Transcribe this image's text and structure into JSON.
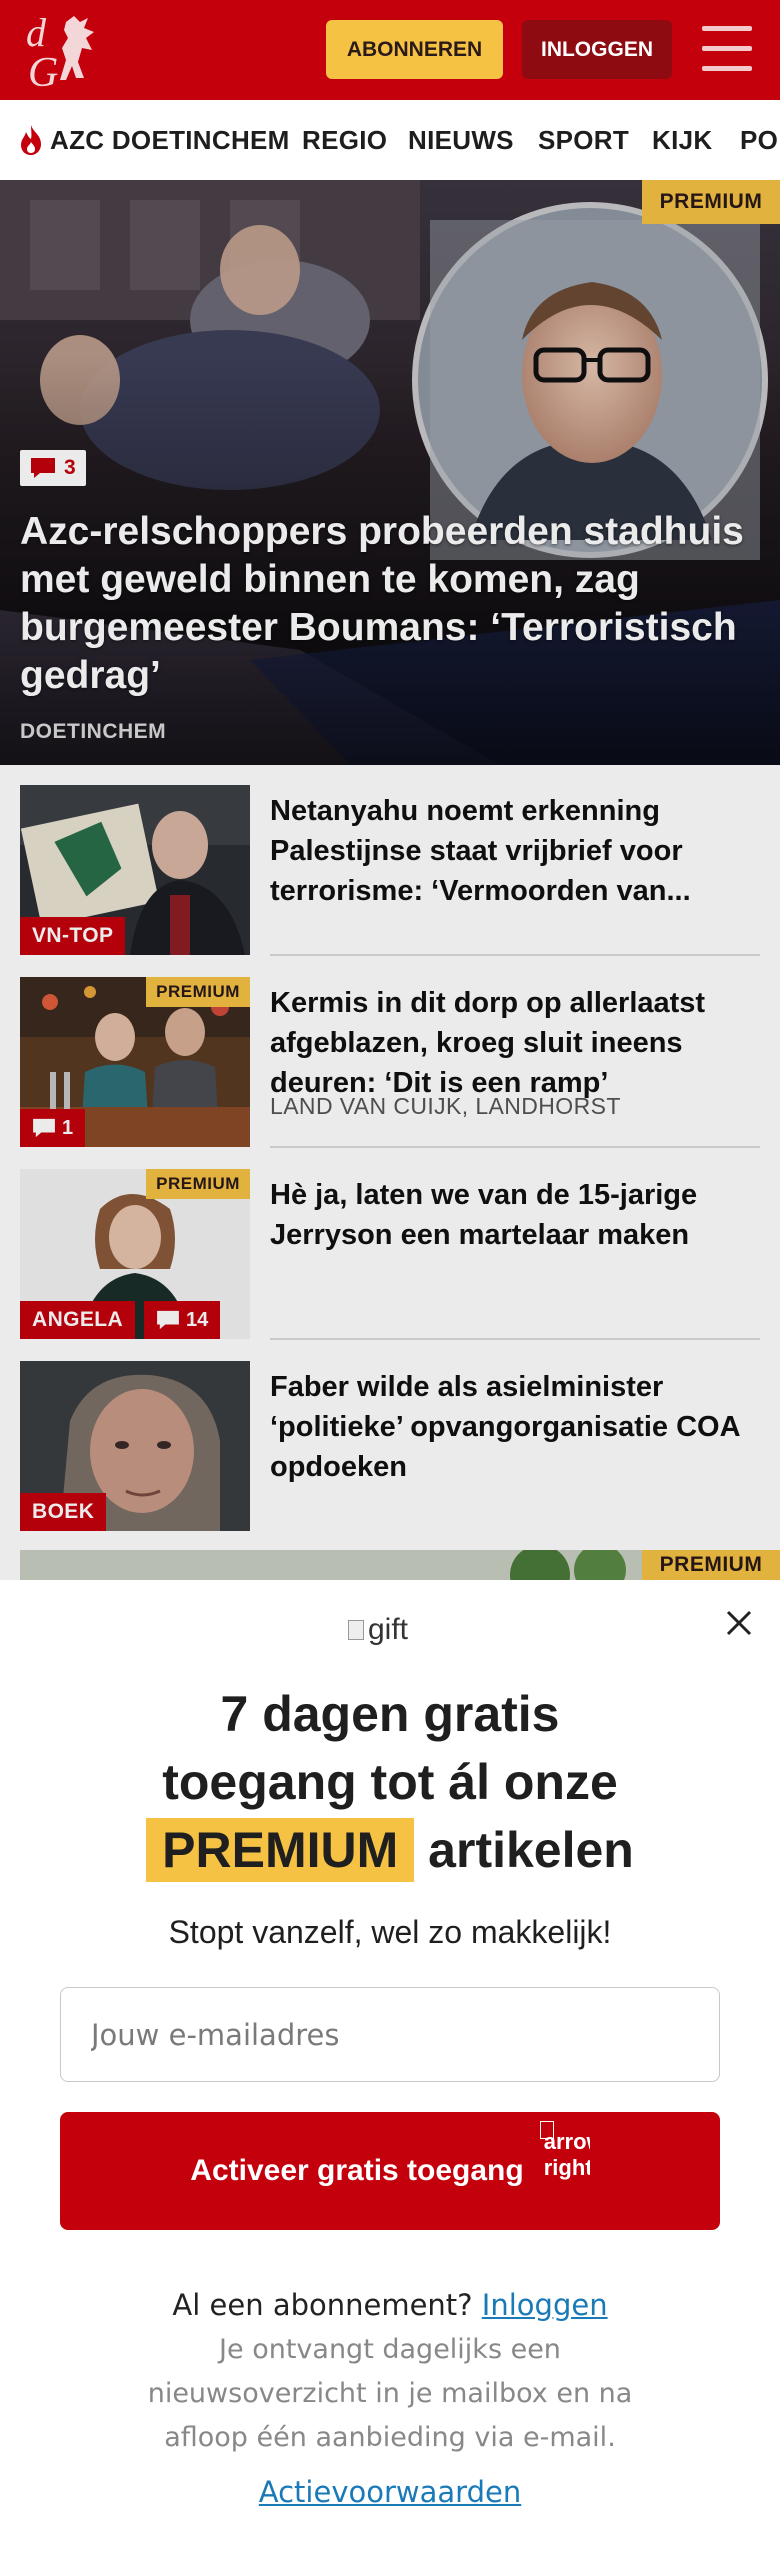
{
  "header": {
    "subscribe_label": "ABONNEREN",
    "login_label": "INLOGGEN",
    "brand_color": "#c4000d",
    "accent_color": "#f6c244"
  },
  "nav": {
    "items": [
      {
        "label": "AZC DOETINCHEM",
        "icon": "flame-icon"
      },
      {
        "label": "REGIO"
      },
      {
        "label": "NIEUWS"
      },
      {
        "label": "SPORT"
      },
      {
        "label": "KIJK"
      },
      {
        "label": "PO"
      }
    ]
  },
  "hero": {
    "premium_label": "PREMIUM",
    "comment_count": "3",
    "title": "Azc-relschoppers probeerden stadhuis met geweld binnen te komen, zag burgemeester Boumans: ‘Terroristisch gedrag’",
    "region": "DOETINCHEM"
  },
  "articles": [
    {
      "kicker": "VN-TOP",
      "title": "Netanyahu noemt erkenning Palestijnse staat vrijbrief voor terrorisme: ‘Vermoorden van...",
      "region": ""
    },
    {
      "premium_label": "PREMIUM",
      "comment_count": "1",
      "title": "Kermis in dit dorp op allerlaatst afgeblazen, kroeg sluit ineens deuren: ‘Dit is een ramp’",
      "region": "LAND VAN CUIJK, LANDHORST"
    },
    {
      "premium_label": "PREMIUM",
      "kicker": "ANGELA",
      "comment_count": "14",
      "title": "Hè ja, laten we van de 15-jarige Jerryson een martelaar maken",
      "region": ""
    },
    {
      "kicker": "BOEK",
      "title": "Faber wilde als asielminister ‘politieke’ opvangorganisatie COA opdoeken",
      "region": ""
    }
  ],
  "next_teaser": {
    "premium_label": "PREMIUM"
  },
  "modal": {
    "gift_alt": "gift",
    "headline_line1": "7 dagen gratis",
    "headline_line2": "toegang tot ál onze",
    "headline_premium": "PREMIUM",
    "headline_rest": "artikelen",
    "subtitle": "Stopt vanzelf, wel zo makkelijk!",
    "email_placeholder": "Jouw e-mailadres",
    "cta_label": "Activeer gratis toegang",
    "arrow_alt": "arrow right",
    "have_subscription": "Al een abonnement?",
    "login_link": "Inloggen",
    "fineprint": "Je ontvangt dagelijks een nieuwsoverzicht in je mailbox en na afloop één aanbieding via e-mail.",
    "terms_link": "Actievoorwaarden"
  }
}
